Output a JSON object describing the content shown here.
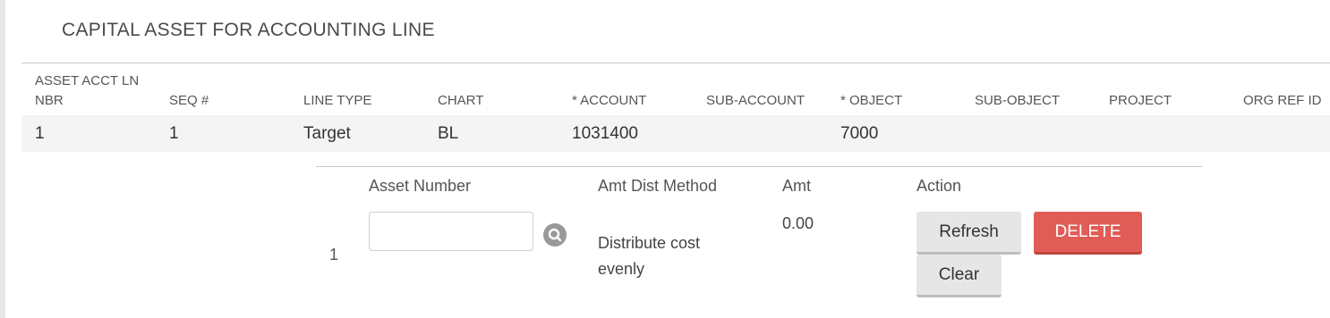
{
  "section": {
    "title": "CAPITAL ASSET FOR ACCOUNTING LINE"
  },
  "accounting_table": {
    "headers": {
      "asset_acct_ln_line1": "ASSET ACCT LN",
      "asset_acct_ln_line2": "NBR",
      "seq": "SEQ #",
      "line_type": "LINE TYPE",
      "chart": "CHART",
      "account": "* ACCOUNT",
      "sub_account": "SUB-ACCOUNT",
      "object": "* OBJECT",
      "sub_object": "SUB-OBJECT",
      "project": "PROJECT",
      "org_ref_id": "ORG REF ID"
    },
    "row": {
      "asset_acct_ln_nbr": "1",
      "seq": "1",
      "line_type": "Target",
      "chart": "BL",
      "account": "1031400",
      "sub_account": "",
      "object": "7000",
      "sub_object": "",
      "project": "",
      "org_ref_id": ""
    }
  },
  "asset_table": {
    "headers": {
      "asset_number": "Asset Number",
      "amt_dist_method": "Amt Dist Method",
      "amt": "Amt",
      "action": "Action"
    },
    "row": {
      "index": "1",
      "asset_number_value": "",
      "asset_number_placeholder": "",
      "amt_dist_method": "Distribute cost evenly",
      "amt": "0.00"
    },
    "actions": {
      "refresh": "Refresh",
      "delete": "DELETE",
      "clear": "Clear"
    }
  },
  "icons": {
    "lookup": "search-icon"
  },
  "colors": {
    "delete_button": "#e05c57",
    "action_button": "#e6e6e6"
  }
}
